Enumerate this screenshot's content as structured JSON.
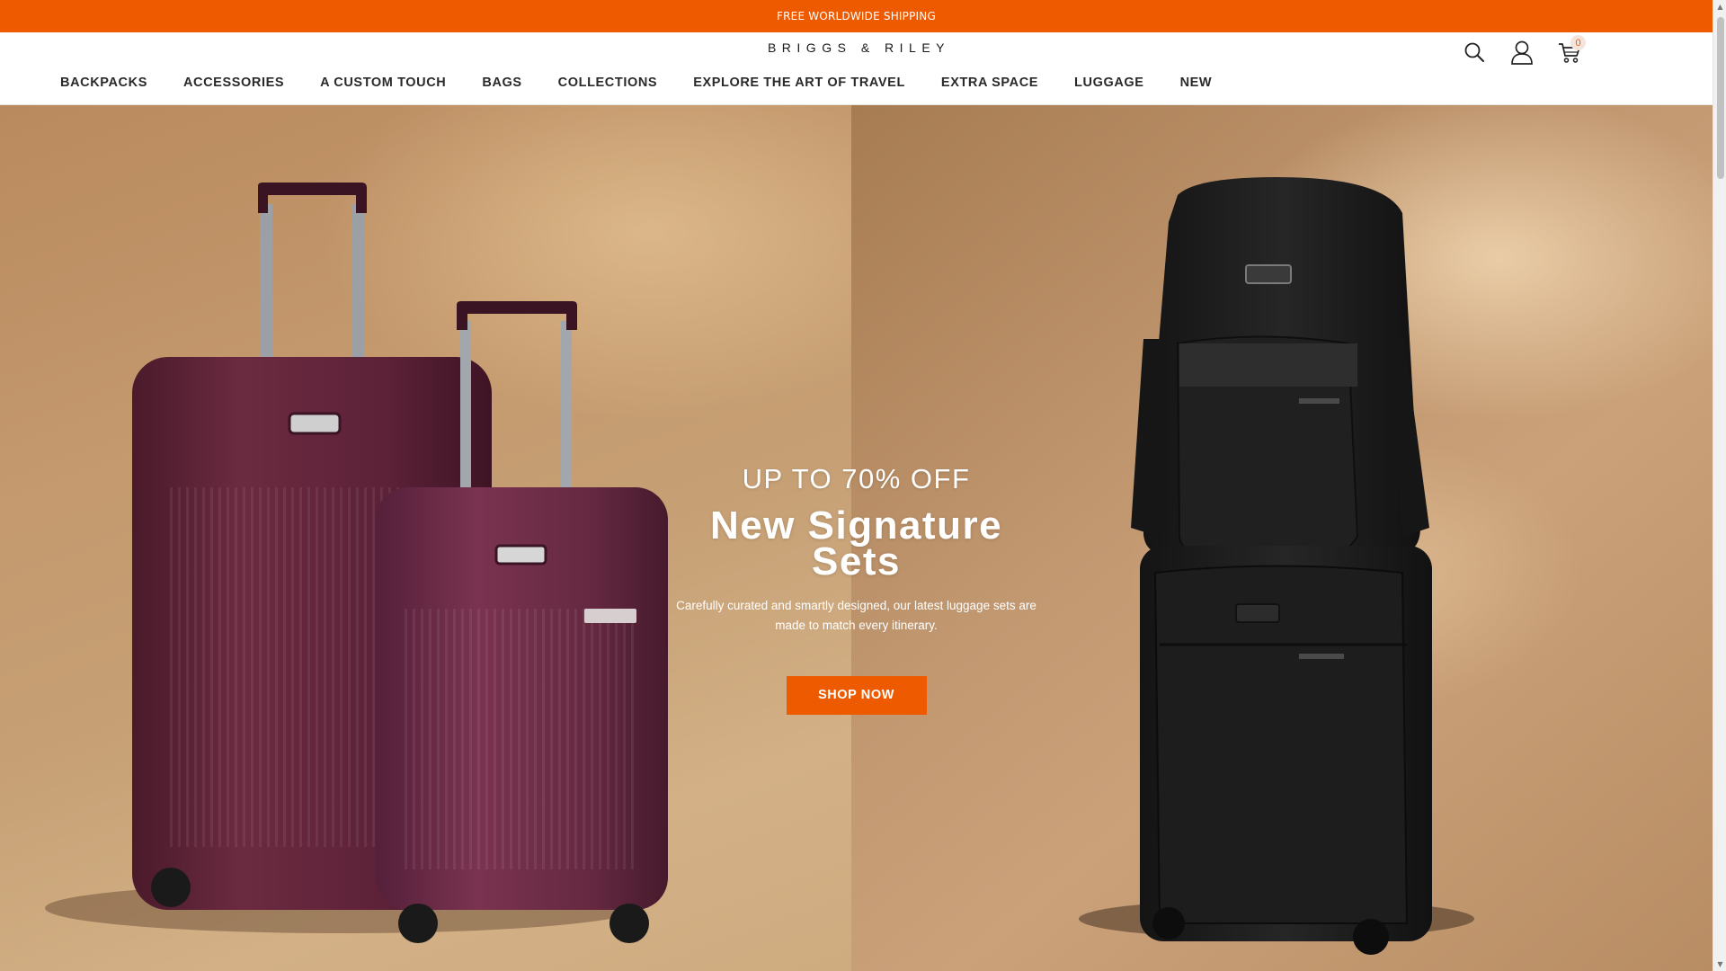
{
  "announcement": {
    "text": "FREE WORLDWIDE SHIPPING"
  },
  "header": {
    "logo": "BRIGGS & RILEY",
    "cart_count": "0",
    "nav": [
      "BACKPACKS",
      "ACCESSORIES",
      "A CUSTOM TOUCH",
      "BAGS",
      "COLLECTIONS",
      "EXPLORE THE ART OF TRAVEL",
      "EXTRA SPACE",
      "LUGGAGE",
      "NEW"
    ]
  },
  "hero": {
    "kicker": "UP TO 70% OFF",
    "title_line1": "New Signature",
    "title_line2": "Sets",
    "description": "Carefully curated and smartly designed, our latest luggage sets are made to match every itinerary.",
    "cta": "SHOP NOW"
  },
  "icons": [
    "search-icon",
    "account-icon",
    "cart-icon"
  ],
  "colors": {
    "accent": "#ee5a00",
    "luggage_plum": "#5a2034",
    "backpack_black": "#1c1c1c"
  }
}
